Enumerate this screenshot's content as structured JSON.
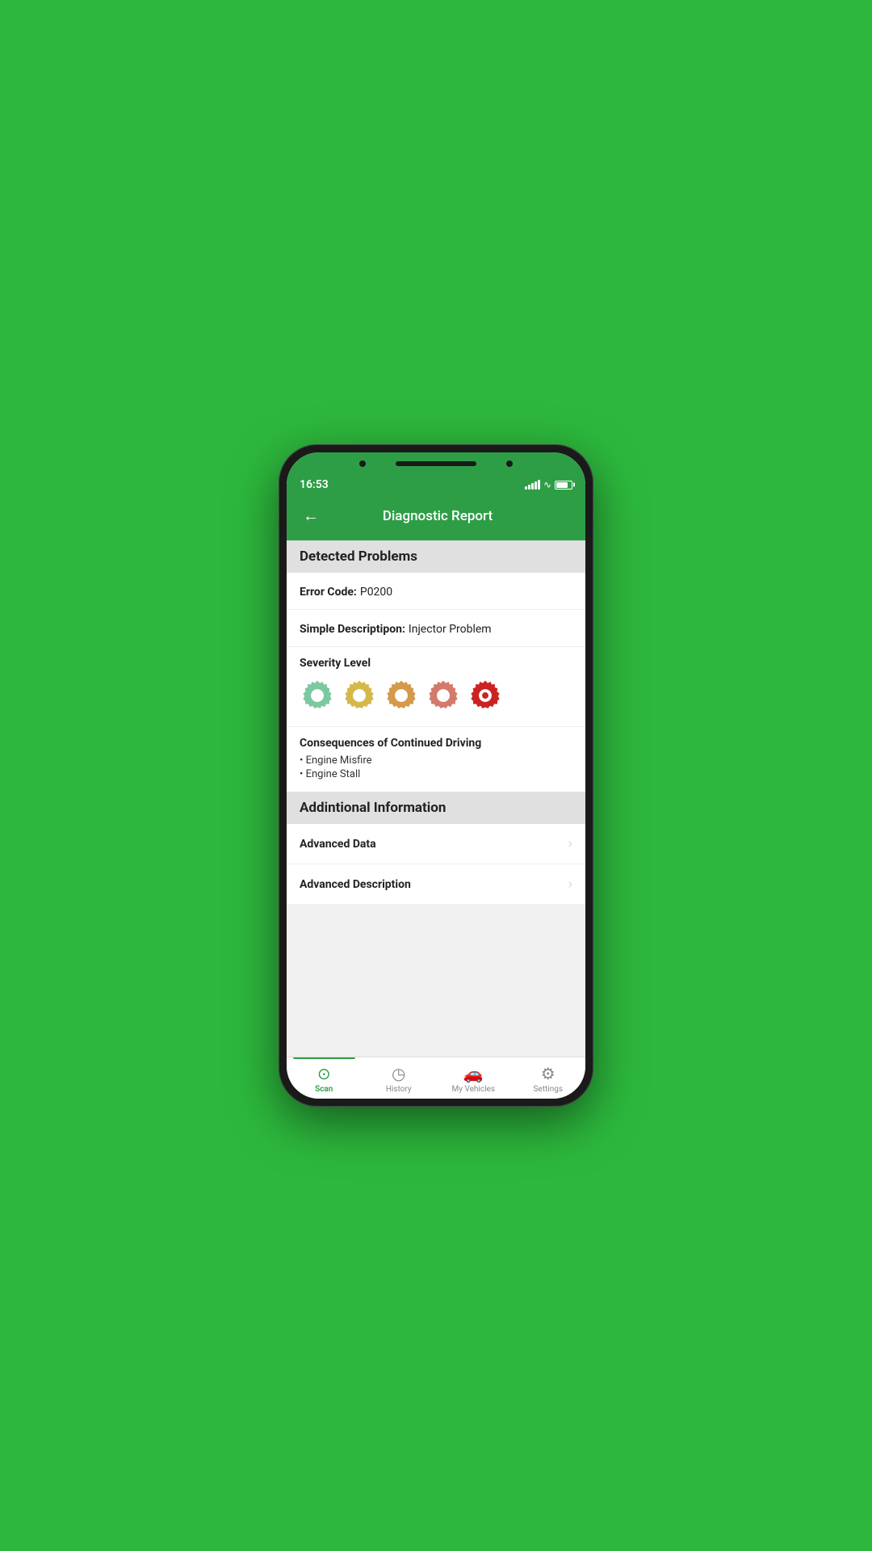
{
  "statusBar": {
    "time": "16:53"
  },
  "header": {
    "title": "Diagnostic Report",
    "backLabel": "←"
  },
  "sections": {
    "detectedProblems": {
      "title": "Detected Problems",
      "errorCodeLabel": "Error Code:",
      "errorCodeValue": "P0200",
      "simpleDescLabel": "Simple Descriptipon:",
      "simpleDescValue": "Injector Problem",
      "severityLabel": "Severity Level",
      "severityCount": 5,
      "consequencesTitle": "Consequences of Continued Driving",
      "consequences": [
        "Engine Misfire",
        "Engine Stall"
      ]
    },
    "additionalInfo": {
      "title": "Addintional Information",
      "items": [
        {
          "label": "Advanced Data"
        },
        {
          "label": "Advanced Description"
        }
      ]
    }
  },
  "bottomNav": {
    "items": [
      {
        "label": "Scan",
        "active": true,
        "icon": "scan"
      },
      {
        "label": "History",
        "active": false,
        "icon": "history"
      },
      {
        "label": "My Vehicles",
        "active": false,
        "icon": "vehicles"
      },
      {
        "label": "Settings",
        "active": false,
        "icon": "settings"
      }
    ]
  },
  "gearColors": [
    "#7cc8a0",
    "#d4b84a",
    "#d4994a",
    "#d47a6a",
    "#cc2222"
  ]
}
